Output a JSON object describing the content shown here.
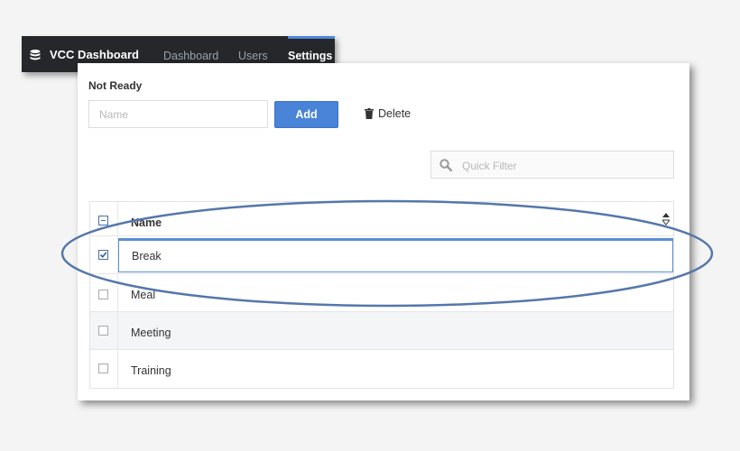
{
  "app": {
    "title": "VCC Dashboard",
    "nav": [
      {
        "label": "Dashboard",
        "active": false
      },
      {
        "label": "Users",
        "active": false
      },
      {
        "label": "Settings",
        "active": true
      }
    ]
  },
  "section": {
    "title": "Not Ready",
    "name_placeholder": "Name",
    "add_label": "Add",
    "delete_label": "Delete"
  },
  "filter": {
    "placeholder": "Quick Filter"
  },
  "table": {
    "header": "Name",
    "editing_value": "Break",
    "rows": [
      {
        "label": "Meal",
        "checked": false
      },
      {
        "label": "Meeting",
        "checked": false
      },
      {
        "label": "Training",
        "checked": false
      }
    ]
  },
  "colors": {
    "accent": "#4a84d8",
    "topbar": "#25272b",
    "annotation": "#5577aa"
  },
  "icons": {
    "brand": "database-icon",
    "delete": "trash-icon",
    "filter": "search-icon",
    "sort": "sort-icon"
  }
}
